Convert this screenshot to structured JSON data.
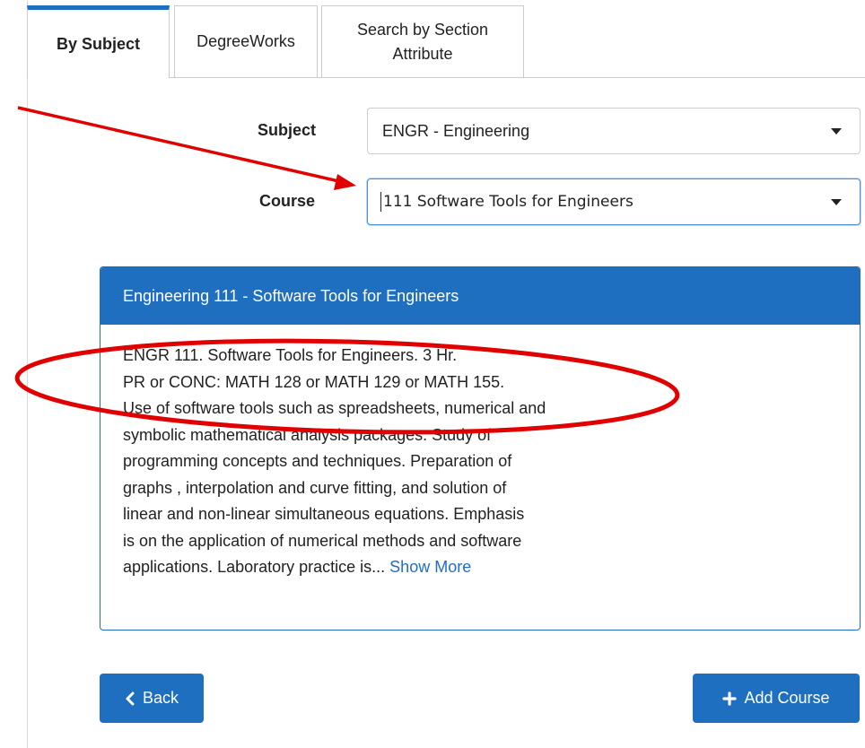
{
  "tabs": [
    {
      "label": "By Subject",
      "active": true
    },
    {
      "label": "DegreeWorks",
      "active": false
    },
    {
      "label": "Search by Section Attribute",
      "active": false
    }
  ],
  "form": {
    "subject_label": "Subject",
    "subject_value": "ENGR - Engineering",
    "course_label": "Course",
    "course_value": "111 Software Tools for Engineers"
  },
  "course_panel": {
    "title": "Engineering 111 - Software Tools for Engineers",
    "description_lines": [
      "ENGR 111. Software Tools for Engineers. 3 Hr.",
      "PR or CONC: MATH 128 or MATH 129 or MATH 155.",
      "Use of software tools such as spreadsheets, numerical and",
      "symbolic mathematical analysis packages. Study of",
      "programming concepts and techniques. Preparation of",
      "graphs , interpolation and curve fitting, and solution of",
      "linear and non-linear simultaneous equations. Emphasis",
      "is on the application of numerical methods and software",
      "applications. Laboratory practice is..."
    ],
    "show_more_label": "Show More"
  },
  "buttons": {
    "back_label": "Back",
    "back_icon": "chevron-left-icon",
    "add_label": "Add Course",
    "add_icon": "plus-icon"
  },
  "colors": {
    "primary": "#1f6fc0",
    "annotation": "#e00000"
  }
}
